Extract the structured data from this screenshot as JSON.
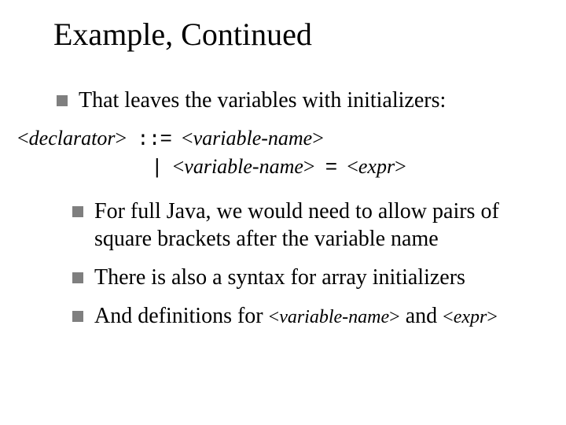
{
  "title": "Example, Continued",
  "bullets": {
    "b1": "That leaves the variables with initializers:",
    "b2": "For full Java, we would need to allow pairs of square brackets after the variable name",
    "b3": "There is also a syntax for array initializers",
    "b4_pre": "And definitions for ",
    "b4_mid": " and "
  },
  "grammar": {
    "lhs": "declarator",
    "op": "::=",
    "rhs1": "variable-name",
    "alt": "|",
    "rhs2a": "variable-name",
    "eq": "=",
    "rhs2b": "expr"
  },
  "inline": {
    "nt1": "variable-name",
    "nt2": "expr"
  },
  "angle": {
    "lt": "<",
    "gt": ">"
  }
}
